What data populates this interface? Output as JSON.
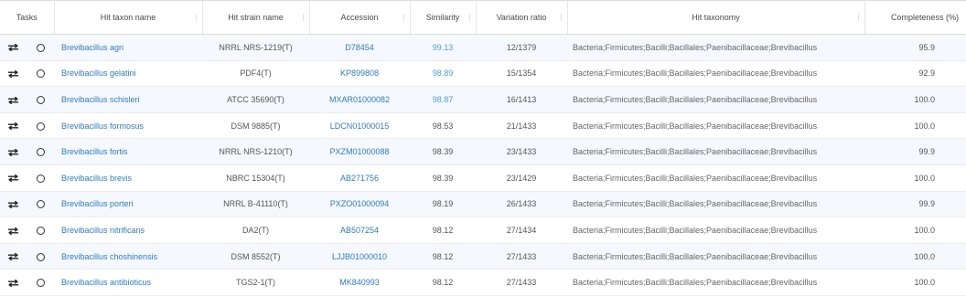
{
  "table": {
    "columns": {
      "tasks": "Tasks",
      "name": "Hit taxon name",
      "strain": "Hit strain name",
      "accession": "Accession",
      "similarity": "Similarity",
      "variation": "Variation ratio",
      "taxonomy": "Hit taxonomy",
      "completeness": "Completeness (%)"
    },
    "icons": {
      "swap": "swap-arrows-icon",
      "select": "radio-circle-icon"
    },
    "rows": [
      {
        "name": "Brevibacillus agri",
        "strain": "NRRL NRS-1219(T)",
        "accession": "D78454",
        "similarity": "99.13",
        "similarity_linked": true,
        "variation": "12/1379",
        "taxonomy": "Bacteria;Firmicutes;Bacilli;Bacillales;Paenibacillaceae;Brevibacillus",
        "completeness": "95.9"
      },
      {
        "name": "Brevibacillus gelatini",
        "strain": "PDF4(T)",
        "accession": "KP899808",
        "similarity": "98.89",
        "similarity_linked": true,
        "variation": "15/1354",
        "taxonomy": "Bacteria;Firmicutes;Bacilli;Bacillales;Paenibacillaceae;Brevibacillus",
        "completeness": "92.9"
      },
      {
        "name": "Brevibacillus schisleri",
        "strain": "ATCC 35690(T)",
        "accession": "MXAR01000082",
        "similarity": "98.87",
        "similarity_linked": true,
        "variation": "16/1413",
        "taxonomy": "Bacteria;Firmicutes;Bacilli;Bacillales;Paenibacillaceae;Brevibacillus",
        "completeness": "100.0"
      },
      {
        "name": "Brevibacillus formosus",
        "strain": "DSM 9885(T)",
        "accession": "LDCN01000015",
        "similarity": "98.53",
        "similarity_linked": false,
        "variation": "21/1433",
        "taxonomy": "Bacteria;Firmicutes;Bacilli;Bacillales;Paenibacillaceae;Brevibacillus",
        "completeness": "100.0"
      },
      {
        "name": "Brevibacillus fortis",
        "strain": "NRRL NRS-1210(T)",
        "accession": "PXZM01000088",
        "similarity": "98.39",
        "similarity_linked": false,
        "variation": "23/1433",
        "taxonomy": "Bacteria;Firmicutes;Bacilli;Bacillales;Paenibacillaceae;Brevibacillus",
        "completeness": "99.9"
      },
      {
        "name": "Brevibacillus brevis",
        "strain": "NBRC 15304(T)",
        "accession": "AB271756",
        "similarity": "98.39",
        "similarity_linked": false,
        "variation": "23/1429",
        "taxonomy": "Bacteria;Firmicutes;Bacilli;Bacillales;Paenibacillaceae;Brevibacillus",
        "completeness": "100.0"
      },
      {
        "name": "Brevibacillus porteri",
        "strain": "NRRL B-41110(T)",
        "accession": "PXZO01000094",
        "similarity": "98.19",
        "similarity_linked": false,
        "variation": "26/1433",
        "taxonomy": "Bacteria;Firmicutes;Bacilli;Bacillales;Paenibacillaceae;Brevibacillus",
        "completeness": "99.9"
      },
      {
        "name": "Brevibacillus nitrificans",
        "strain": "DA2(T)",
        "accession": "AB507254",
        "similarity": "98.12",
        "similarity_linked": false,
        "variation": "27/1434",
        "taxonomy": "Bacteria;Firmicutes;Bacilli;Bacillales;Paenibacillaceae;Brevibacillus",
        "completeness": "100.0"
      },
      {
        "name": "Brevibacillus choshinensis",
        "strain": "DSM 8552(T)",
        "accession": "LJJB01000010",
        "similarity": "98.12",
        "similarity_linked": false,
        "variation": "27/1433",
        "taxonomy": "Bacteria;Firmicutes;Bacilli;Bacillales;Paenibacillaceae;Brevibacillus",
        "completeness": "100.0"
      },
      {
        "name": "Brevibacillus antibioticus",
        "strain": "TGS2-1(T)",
        "accession": "MK840993",
        "similarity": "98.12",
        "similarity_linked": false,
        "variation": "27/1433",
        "taxonomy": "Bacteria;Firmicutes;Bacilli;Bacillales;Paenibacillaceae;Brevibacillus",
        "completeness": "100.0"
      }
    ]
  }
}
